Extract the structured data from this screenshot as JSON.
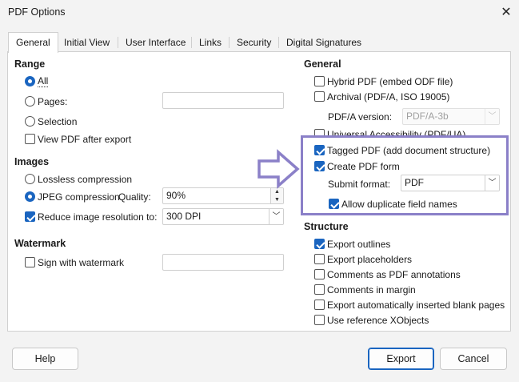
{
  "window": {
    "title": "PDF Options"
  },
  "tabs": [
    {
      "label": "General",
      "active": true
    },
    {
      "label": "Initial View"
    },
    {
      "label": "User Interface"
    },
    {
      "label": "Links"
    },
    {
      "label": "Security"
    },
    {
      "label": "Digital Signatures"
    }
  ],
  "range": {
    "heading": "Range",
    "all": "All",
    "pages": "Pages:",
    "selection": "Selection",
    "view_pdf": "View PDF after export"
  },
  "images": {
    "heading": "Images",
    "lossless": "Lossless compression",
    "jpeg": "JPEG compression",
    "quality_label": "Quality:",
    "quality_value": "90%",
    "reduce": "Reduce image resolution to:",
    "resolution_value": "300 DPI"
  },
  "watermark": {
    "heading": "Watermark",
    "sign": "Sign with watermark"
  },
  "general": {
    "heading": "General",
    "hybrid": "Hybrid PDF (embed ODF file)",
    "archival": "Archival (PDF/A, ISO 19005)",
    "pdfa_label": "PDF/A version:",
    "pdfa_value": "PDF/A-3b",
    "universal": "Universal Accessibility (PDF/UA)",
    "tagged": "Tagged PDF (add document structure)",
    "create_form": "Create PDF form",
    "submit_label": "Submit format:",
    "submit_value": "PDF",
    "allow_dup": "Allow duplicate field names"
  },
  "structure": {
    "heading": "Structure",
    "outlines": "Export outlines",
    "placeholders": "Export placeholders",
    "comments_pdf": "Comments as PDF annotations",
    "comments_margin": "Comments in margin",
    "blank_pages": "Export automatically inserted blank pages",
    "xobjects": "Use reference XObjects"
  },
  "buttons": {
    "help": "Help",
    "export": "Export",
    "cancel": "Cancel"
  },
  "colors": {
    "accent": "#1a65c0",
    "annotation": "#8b80c8"
  }
}
